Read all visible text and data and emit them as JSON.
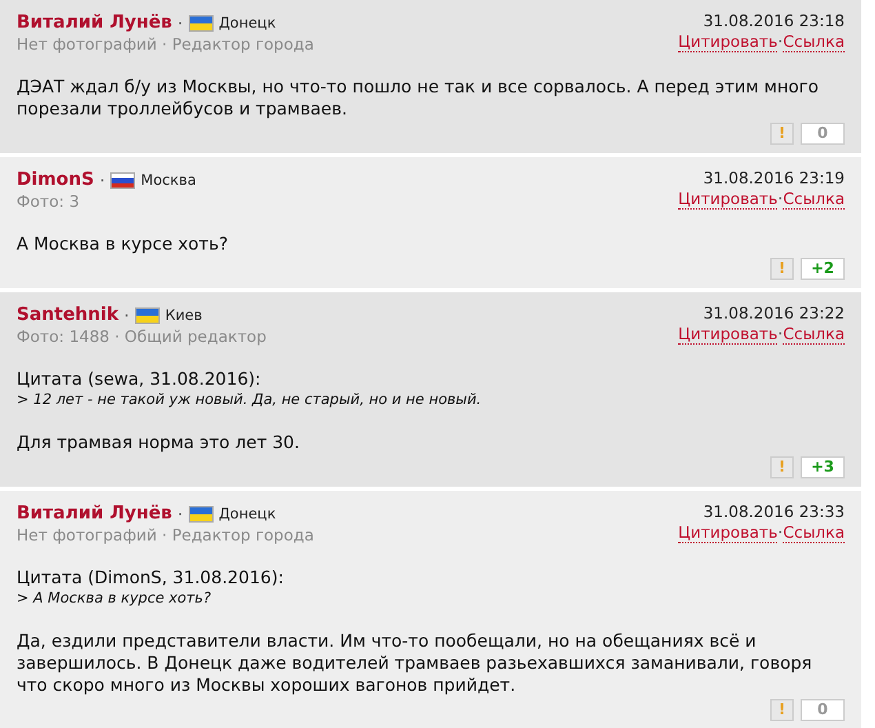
{
  "posts": [
    {
      "author": "Виталий Лунёв",
      "author_sep": "·",
      "flag": {
        "kind": "ukraine"
      },
      "city": "Донецк",
      "meta": "Нет фотографий · Редактор города",
      "date": "31.08.2016 23:18",
      "quote_link": "Цитировать",
      "link_sep": "·",
      "link": "Ссылка",
      "text": "ДЭАТ ждал б/у из Москвы, но что-то пошло не так и все сорвалось. А перед этим много порезали троллейбусов и трамваев.",
      "warn": "!",
      "score": {
        "text": "0",
        "kind": "neutral"
      }
    },
    {
      "author": "DimonS",
      "author_sep": "·",
      "flag": {
        "kind": "russia"
      },
      "city": "Москва",
      "meta": "Фото: 3",
      "date": "31.08.2016 23:19",
      "quote_link": "Цитировать",
      "link_sep": "·",
      "link": "Ссылка",
      "text": "А Москва в курсе хоть?",
      "warn": "!",
      "score": {
        "text": "+2",
        "kind": "positive"
      }
    },
    {
      "author": "Santehnik",
      "author_sep": "·",
      "flag": {
        "kind": "ukraine"
      },
      "city": "Киев",
      "meta": "Фото: 1488 · Общий редактор",
      "date": "31.08.2016 23:22",
      "quote_link": "Цитировать",
      "link_sep": "·",
      "link": "Ссылка",
      "quote": {
        "header": "Цитата (sewa, 31.08.2016):",
        "text": "> 12 лет - не такой уж новый. Да, не старый, но и не новый."
      },
      "text": "Для трамвая норма это лет 30.",
      "warn": "!",
      "score": {
        "text": "+3",
        "kind": "positive"
      }
    },
    {
      "author": "Виталий Лунёв",
      "author_sep": "·",
      "flag": {
        "kind": "ukraine"
      },
      "city": "Донецк",
      "meta": "Нет фотографий · Редактор города",
      "date": "31.08.2016 23:33",
      "quote_link": "Цитировать",
      "link_sep": "·",
      "link": "Ссылка",
      "quote": {
        "header": "Цитата (DimonS, 31.08.2016):",
        "text": "> А Москва в курсе хоть?"
      },
      "text": "Да, ездили представители власти. Им что-то пообещали, но на обещаниях всё и завершилось. В Донецк даже водителей трамваев разьехавшихся заманивали, говоря что скоро много из Москвы хороших вагонов прийдет.",
      "warn": "!",
      "score": {
        "text": "0",
        "kind": "neutral"
      }
    }
  ]
}
